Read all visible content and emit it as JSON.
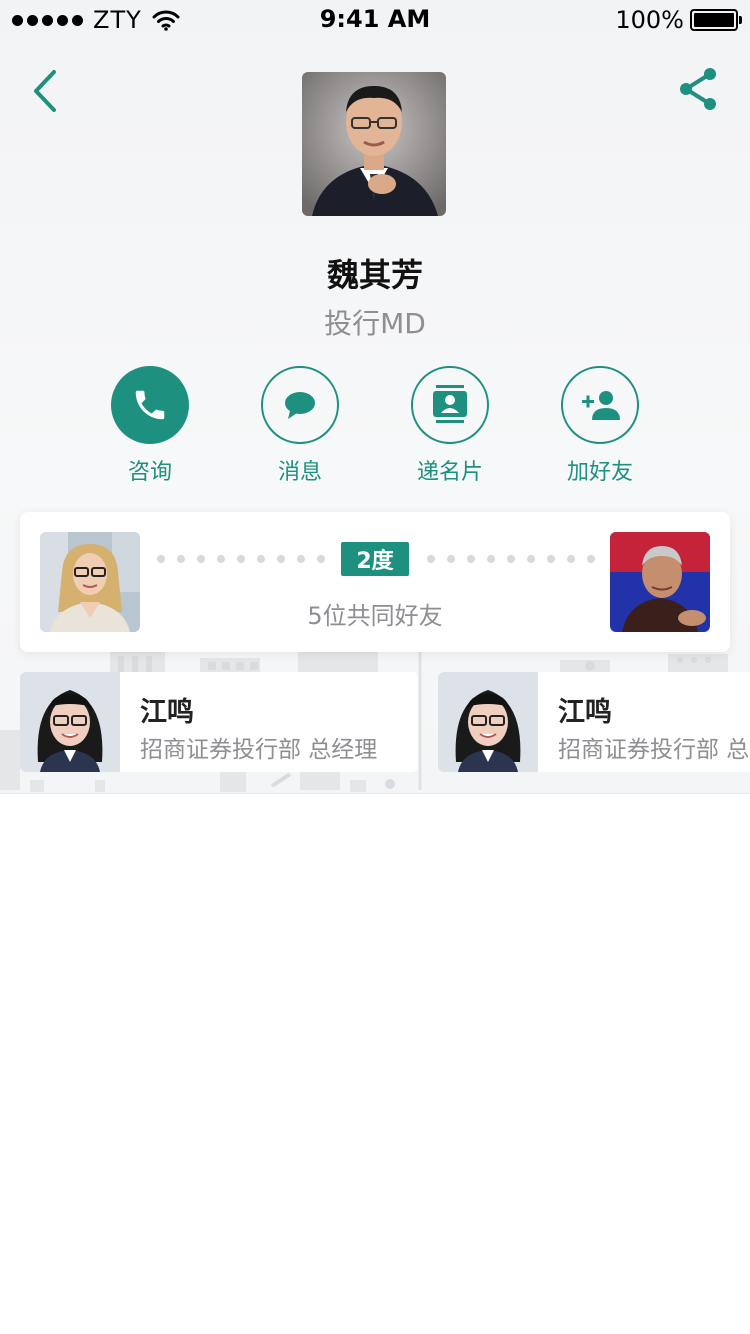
{
  "status_bar": {
    "carrier": "ZTY",
    "time": "9:41 AM",
    "battery": "100%",
    "battery_level": 1.0
  },
  "nav": {
    "back_icon": "chevron-left-icon",
    "share_icon": "share-icon"
  },
  "profile": {
    "name": "魏其芳",
    "title": "投行MD"
  },
  "actions": [
    {
      "label": "咨询",
      "icon": "phone-icon"
    },
    {
      "label": "消息",
      "icon": "chat-bubble-icon"
    },
    {
      "label": "递名片",
      "icon": "contact-card-icon"
    },
    {
      "label": "加好友",
      "icon": "add-friend-icon"
    }
  ],
  "connection": {
    "degree": "2度",
    "mutual_friends": "5位共同好友"
  },
  "friends": [
    {
      "name": "江鸣",
      "description": "招商证券投行部 总经理"
    },
    {
      "name": "江鸣",
      "description": "招商证券投行部 总经理"
    }
  ],
  "colors": {
    "accent": "#1e9080",
    "secondary_text": "#8e8e93",
    "background": "#f4f5f6"
  }
}
